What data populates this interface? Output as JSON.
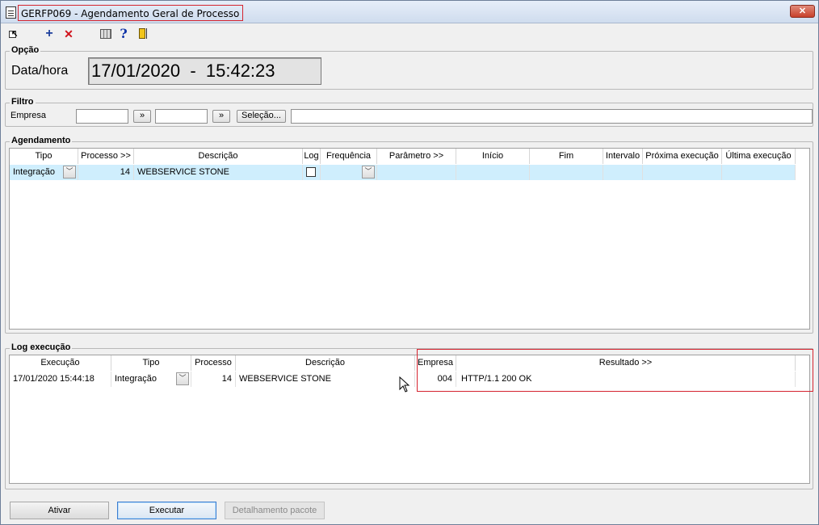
{
  "window": {
    "title": "GERFP069 - Agendamento Geral de Processo",
    "close_label": "✕"
  },
  "toolbar": {
    "icons": [
      "exit-icon",
      "add-icon",
      "delete-icon",
      "grid-icon",
      "help-icon",
      "door-icon"
    ],
    "add_glyph": "+",
    "delete_glyph": "✕",
    "help_glyph": "?"
  },
  "opcao": {
    "title": "Opção",
    "label": "Data/hora",
    "value": "17/01/2020  -  15:42:23"
  },
  "filtro": {
    "title": "Filtro",
    "label": "Empresa",
    "from_value": "",
    "to_value": "",
    "lookup_label": "»",
    "selecao_label": "Seleção...",
    "selecao_value": ""
  },
  "agendamento": {
    "title": "Agendamento",
    "columns": [
      "Tipo",
      "Processo >>",
      "Descrição",
      "Log",
      "Frequência",
      "Parâmetro >>",
      "Início",
      "Fim",
      "Intervalo",
      "Próxima execução",
      "Última execução"
    ],
    "rows": [
      {
        "tipo": "Integração",
        "processo": "14",
        "descricao": "WEBSERVICE STONE",
        "log": false,
        "frequencia": "",
        "parametro": "",
        "inicio": "",
        "fim": "",
        "intervalo": "",
        "proxima": "",
        "ultima": ""
      }
    ]
  },
  "log": {
    "title": "Log execução",
    "columns": [
      "Execução",
      "Tipo",
      "Processo",
      "Descrição",
      "Empresa",
      "Resultado >>"
    ],
    "rows": [
      {
        "execucao": "17/01/2020 15:44:18",
        "tipo": "Integração",
        "processo": "14",
        "descricao": "WEBSERVICE STONE",
        "empresa": "004",
        "resultado": "HTTP/1.1 200 OK"
      }
    ]
  },
  "buttons": {
    "ativar": "Ativar",
    "executar": "Executar",
    "detalhamento": "Detalhamento pacote"
  },
  "colors": {
    "selected_row": "#cfeefd",
    "highlight_box": "#d5242f"
  }
}
